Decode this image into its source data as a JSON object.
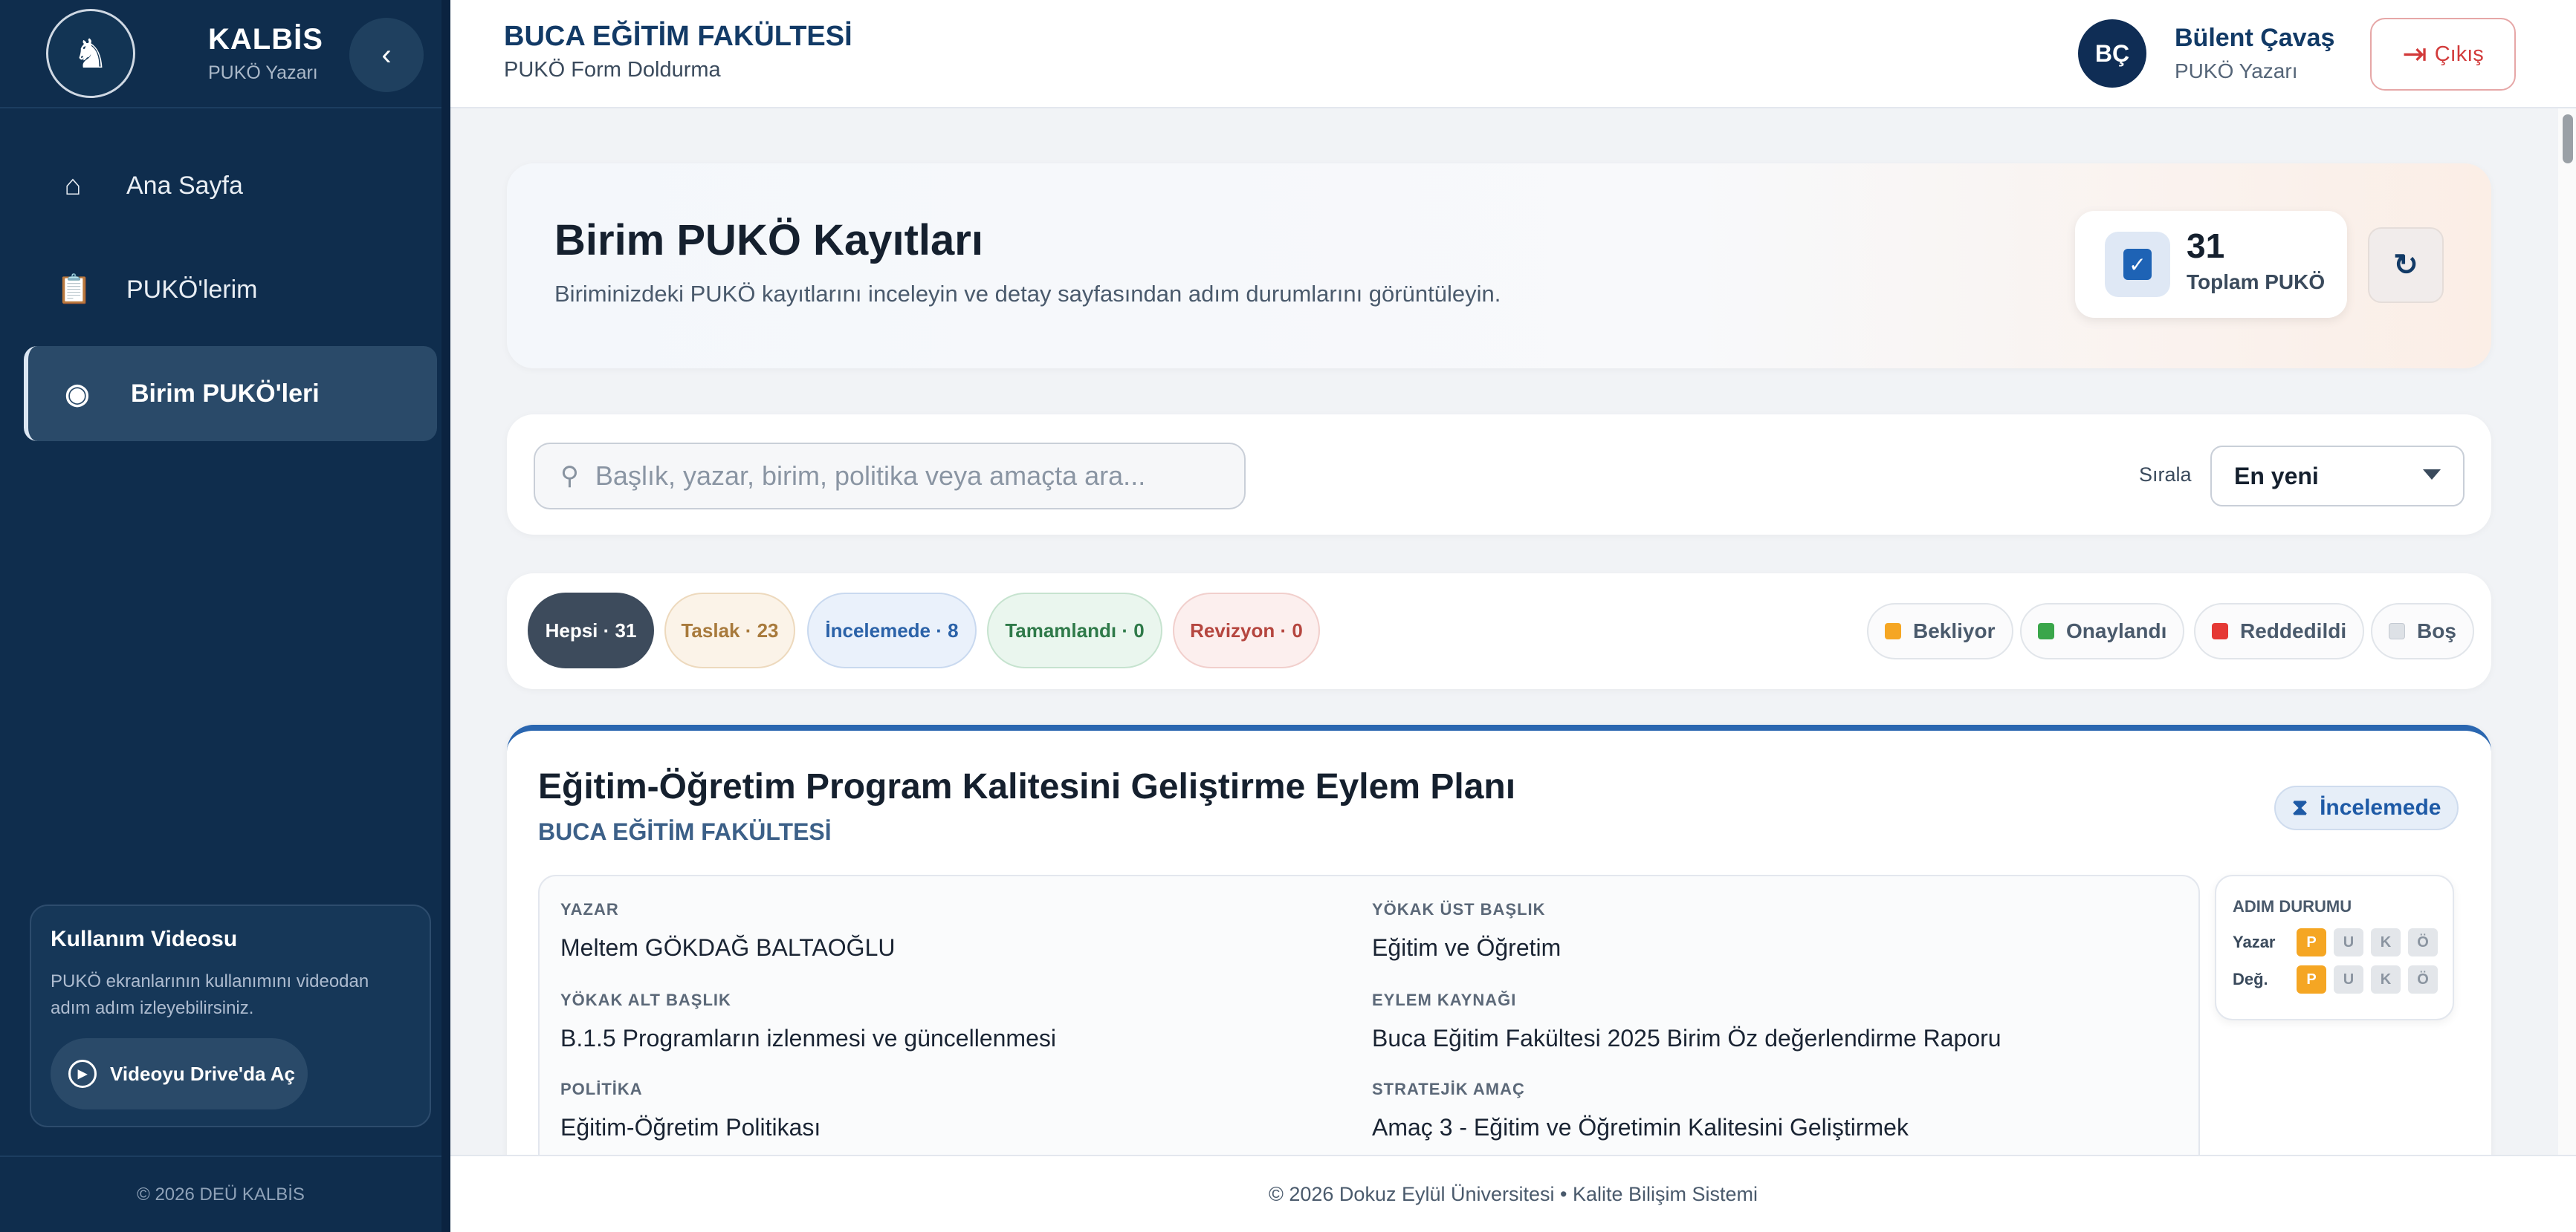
{
  "sidebar": {
    "brand_title": "KALBİS",
    "brand_sub": "PUKÖ Yazarı",
    "collapse_icon": "chevron-left-icon",
    "items": [
      {
        "label": "Ana Sayfa",
        "icon": "home-icon"
      },
      {
        "label": "PUKÖ'lerim",
        "icon": "clipboard-icon"
      },
      {
        "label": "Birim PUKÖ'leri",
        "icon": "eye-icon"
      }
    ],
    "video_title": "Kullanım Videosu",
    "video_desc": "PUKÖ ekranlarının kullanımını videodan adım adım izleyebilirsiniz.",
    "video_button": "Videoyu Drive'da Aç",
    "footer": "© 2026 DEÜ KALBİS"
  },
  "header": {
    "faculty": "BUCA EĞİTİM FAKÜLTESİ",
    "subtitle": "PUKÖ Form Doldurma",
    "avatar_initials": "BÇ",
    "user_name": "Bülent Çavaş",
    "user_role": "PUKÖ Yazarı",
    "logout_label": "Çıkış"
  },
  "hero": {
    "title": "Birim PUKÖ Kayıtları",
    "subtitle": "Biriminizdeki PUKÖ kayıtlarını inceleyin ve detay sayfasından adım durumlarını görüntüleyin.",
    "total_count": "31",
    "total_label": "Toplam PUKÖ"
  },
  "search": {
    "placeholder": "Başlık, yazar, birim, politika veya amaçta ara...",
    "sort_label": "Sırala",
    "sort_value": "En yeni"
  },
  "filters": [
    {
      "label": "Hepsi · 31"
    },
    {
      "label": "Taslak · 23"
    },
    {
      "label": "İncelemede · 8"
    },
    {
      "label": "Tamamlandı · 0"
    },
    {
      "label": "Revizyon · 0"
    }
  ],
  "legend": [
    {
      "label": "Bekliyor",
      "color": "#f5a623"
    },
    {
      "label": "Onaylandı",
      "color": "#3aa64a"
    },
    {
      "label": "Reddedildi",
      "color": "#e53935"
    },
    {
      "label": "Boş",
      "color": "#dde1e6"
    }
  ],
  "card": {
    "title": "Eğitim-Öğretim Program Kalitesini Geliştirme Eylem Planı",
    "unit": "BUCA EĞİTİM FAKÜLTESİ",
    "status": "İncelemede",
    "fields": [
      {
        "key": "YAZAR",
        "value": "Meltem GÖKDAĞ BALTAOĞLU"
      },
      {
        "key": "YÖKAK ÜST BAŞLIK",
        "value": "Eğitim ve Öğretim"
      },
      {
        "key": "YÖKAK ALT BAŞLIK",
        "value": "B.1.5 Programların izlenmesi ve güncellenmesi"
      },
      {
        "key": "EYLEM KAYNAĞI",
        "value": "Buca Eğitim Fakültesi 2025 Birim Öz değerlendirme Raporu"
      },
      {
        "key": "POLİTİKA",
        "value": "Eğitim-Öğretim Politikası"
      },
      {
        "key": "STRATEJİK AMAÇ",
        "value": "Amaç 3 - Eğitim ve Öğretimin Kalitesini Geliştirmek"
      }
    ],
    "adim": {
      "title": "ADIM DURUMU",
      "rows": [
        {
          "label": "Yazar",
          "steps": [
            "P",
            "U",
            "K",
            "Ö"
          ]
        },
        {
          "label": "Değ.",
          "steps": [
            "P",
            "U",
            "K",
            "Ö"
          ]
        }
      ]
    }
  },
  "footer": "© 2026 Dokuz Eylül Üniversitesi • Kalite Bilişim Sistemi"
}
